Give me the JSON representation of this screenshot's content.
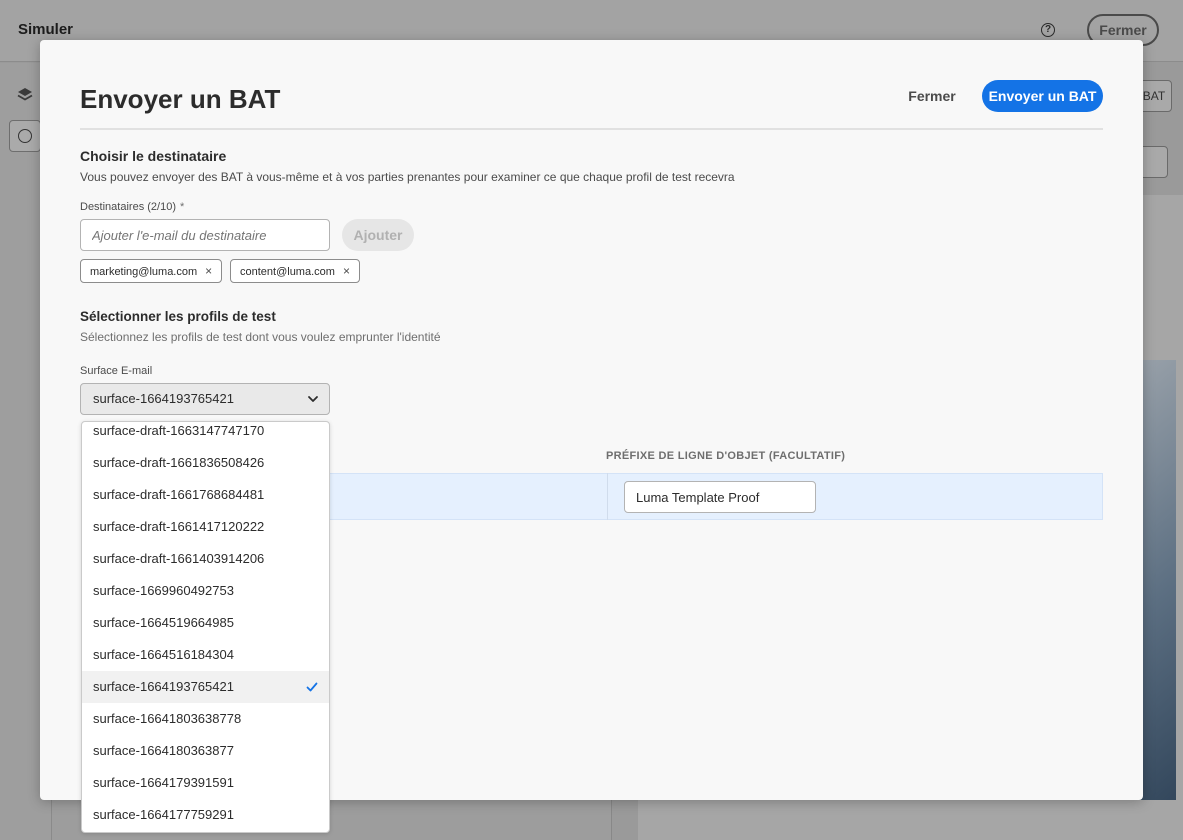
{
  "background": {
    "app_title": "Simuler",
    "help_icon": "help-circle-icon",
    "close_label": "Fermer",
    "side_button_label": "BAT"
  },
  "modal": {
    "title": "Envoyer un BAT",
    "close_label": "Fermer",
    "send_label": "Envoyer un BAT",
    "recipient_section": {
      "heading": "Choisir le destinataire",
      "description": "Vous pouvez envoyer des BAT à vous-même et à vos parties prenantes pour examiner ce que chaque profil de test recevra",
      "field_label": "Destinataires (2/10)",
      "required_mark": "*",
      "email_placeholder": "Ajouter l'e-mail du destinataire",
      "add_label": "Ajouter",
      "tags": [
        {
          "email": "marketing@luma.com",
          "remove": "×"
        },
        {
          "email": "content@luma.com",
          "remove": "×"
        }
      ]
    },
    "profiles_section": {
      "heading": "Sélectionner les profils de test",
      "description": "Sélectionnez les profils de test dont vous voulez emprunter l'identité",
      "surface_label": "Surface E-mail",
      "surface_selected": "surface-1664193765421",
      "column_header": "PRÉFIXE DE LIGNE D'OBJET (FACULTATIF)",
      "prefix_value": "Luma Template Proof"
    },
    "surface_options": [
      "surface-draft-1663147747170",
      "surface-draft-1661836508426",
      "surface-draft-1661768684481",
      "surface-draft-1661417120222",
      "surface-draft-1661403914206",
      "surface-1669960492753",
      "surface-1664519664985",
      "surface-1664516184304",
      "surface-1664193765421",
      "surface-16641803638778",
      "surface-1664180363877",
      "surface-1664179391591",
      "surface-1664177759291"
    ],
    "selected_option_index": 8
  },
  "colors": {
    "accent": "#1473e6",
    "row_highlight": "#e5f0fe"
  }
}
